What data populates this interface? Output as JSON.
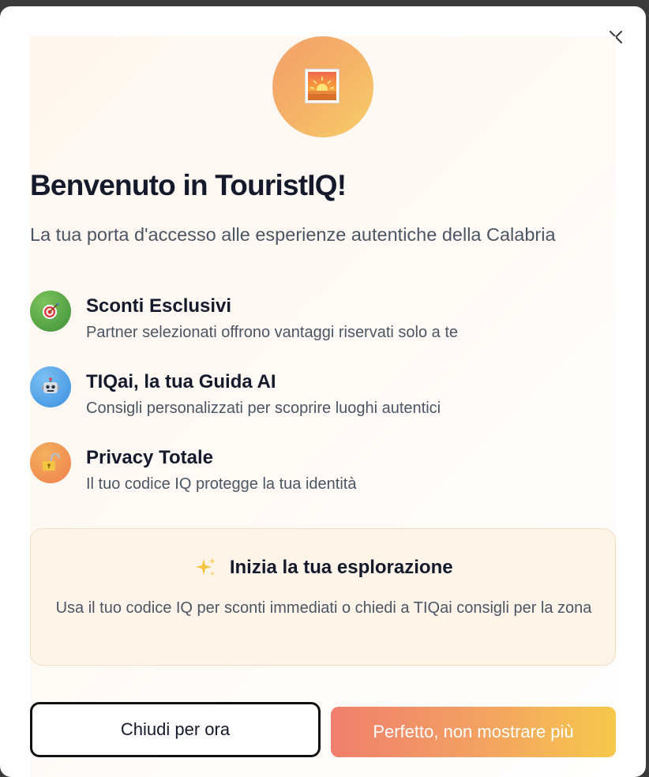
{
  "dialog": {
    "title": "Benvenuto in TouristIQ!",
    "subtitle": "La tua porta d'accesso alle esperienze autentiche della Calabria",
    "hero_icon": "sunrise-icon",
    "close_icon": "close-icon"
  },
  "features": [
    {
      "icon": "target-icon",
      "title": "Sconti Esclusivi",
      "description": "Partner selezionati offrono vantaggi riservati solo a te",
      "icon_color": "#5aa24a"
    },
    {
      "icon": "robot-icon",
      "title": "TIQai, la tua Guida AI",
      "description": "Consigli personalizzati per scoprire luoghi autentici",
      "icon_color": "#4aa3e8"
    },
    {
      "icon": "unlock-icon",
      "title": "Privacy Totale",
      "description": "Il tuo codice IQ protegge la tua identità",
      "icon_color": "#f29a55"
    }
  ],
  "callout": {
    "icon": "sparkles-icon",
    "title": "Inizia la tua esplorazione",
    "description": "Usa il tuo codice IQ per sconti immediati o chiedi a TIQai consigli per la zona"
  },
  "buttons": {
    "secondary_label": "Chiudi per ora",
    "primary_label": "Perfetto, non mostrare più"
  },
  "colors": {
    "accent_start": "#ef7f6d",
    "accent_end": "#f6c84c",
    "text_dark": "#141a2b",
    "text_muted": "#4b5563"
  }
}
